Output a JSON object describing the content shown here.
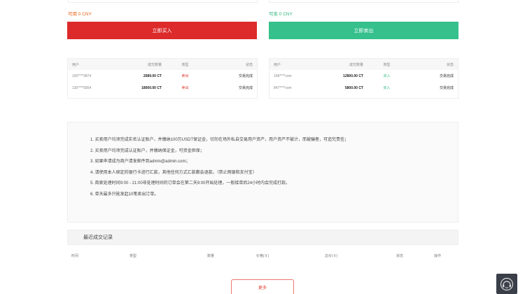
{
  "balances": {
    "buy": "可用 0 CNY",
    "sell": "可卖 0 CNY"
  },
  "buttons": {
    "buy": "立即买入",
    "sell": "立即卖出",
    "more": "更多"
  },
  "buy_orders": {
    "headers": [
      "用户",
      "成交数量",
      "类型",
      "状态"
    ],
    "rows": [
      {
        "user": "150****3874",
        "amount": "2089.00 CT",
        "dir": "卖出",
        "status": "交易完成"
      },
      {
        "user": "130****5854",
        "amount": "18000.00 CT",
        "dir": "卖出",
        "status": "交易完成"
      }
    ]
  },
  "sell_orders": {
    "headers": [
      "用户",
      "成交数量",
      "类型",
      "状态"
    ],
    "rows": [
      {
        "user": "158****com",
        "amount": "12800.00 CT",
        "dir": "买入",
        "status": "交易完成"
      },
      {
        "user": "847****com",
        "amount": "5800.00 CT",
        "dir": "买入",
        "status": "交易完成"
      }
    ]
  },
  "notice": [
    "1. 买卖用户均须完成实名认证账户，并缴纳100万USDT保证金，切勿在场外私自交易用户资产，用户资产不被计，而被骗者，可追究责任；",
    "2. 买卖用户均须完成认证账户，并缴纳保证金，可资金担保；",
    "3. 如果申请成为商户请发邮件到admin@admin.com；",
    "4. 请使用本人绑定的银行卡进行汇款，其他任何方式汇款都会退款。（禁止网银和支付宝）",
    "5. 商家处理时间9:00 - 21:00非处理时间的订单会在第二天9:00开始处理，一般接单后24小时内会完成打款。",
    "6. 单天最多只能发起10笔卖出订单。"
  ],
  "history": {
    "title": "最近成交记录",
    "columns": [
      "时间",
      "类型",
      "数量",
      "价格(￥)",
      "总价(￥)",
      "状态",
      "操作"
    ]
  },
  "colors": {
    "buy": "#dd2a2a",
    "sell": "#35c08c",
    "buy_balance": "#e8641b",
    "sell_balance": "#2eb67d"
  },
  "icons": {
    "customer_service": "headset-icon"
  }
}
